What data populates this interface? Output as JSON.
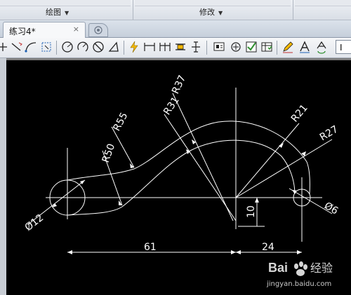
{
  "ribbon": {
    "panels": [
      {
        "label": "绘图"
      },
      {
        "label": "修改"
      }
    ]
  },
  "tabs": {
    "active_label": "练习4*",
    "close_glyph": "×"
  },
  "toolbar": {
    "icons": [
      "move-icon",
      "line-icon",
      "arc-icon",
      "select-box-icon",
      "circle-icon",
      "rotate-icon",
      "no-entry-icon",
      "triangle-icon",
      "lightning-icon",
      "linear-dimension-icon",
      "baseline-dimension-icon",
      "continue-dimension-icon",
      "tolerance-icon",
      "center-mark-icon",
      "block-icon",
      "center-icon",
      "check-icon",
      "table-icon",
      "edit-icon",
      "text-style-icon",
      "text-update-icon"
    ],
    "layer_value": "I"
  },
  "drawing": {
    "labels": {
      "r37": "R37",
      "r31": "R31",
      "r55": "R55",
      "r50": "R50",
      "r21": "R21",
      "r27": "R27",
      "d12": "Ø12",
      "d6": "Ø6",
      "dim10": "10",
      "dim61": "61",
      "dim24": "24"
    }
  },
  "watermark": {
    "brand": "Bai",
    "brand_suffix": "经验",
    "site": "jingyan.baidu.com"
  },
  "colors": {
    "canvas": "#000000",
    "geometry": "#ffffff",
    "ribbon": "#dde2ea"
  }
}
